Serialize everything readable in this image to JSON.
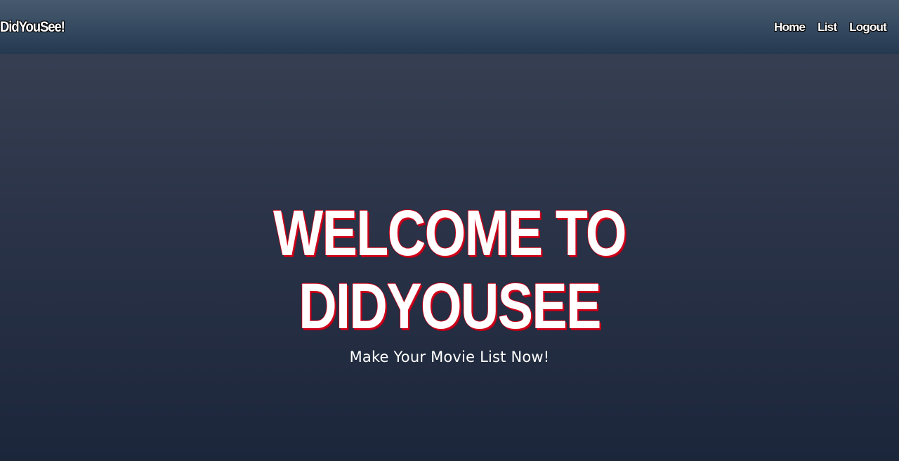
{
  "navbar": {
    "brand": "DidYouSee!",
    "links": [
      {
        "label": "Home"
      },
      {
        "label": "List"
      },
      {
        "label": "Logout"
      }
    ]
  },
  "hero": {
    "title_line1": "WELCOME TO",
    "title_line2": "DIDYOUSEE",
    "subtitle": "Make Your Movie List Now!"
  },
  "colors": {
    "background_top": "#3a4356",
    "background_bottom": "#1c263b",
    "navbar": "#34495f",
    "title_text": "#ffffff",
    "title_outline": "#d0021b"
  }
}
